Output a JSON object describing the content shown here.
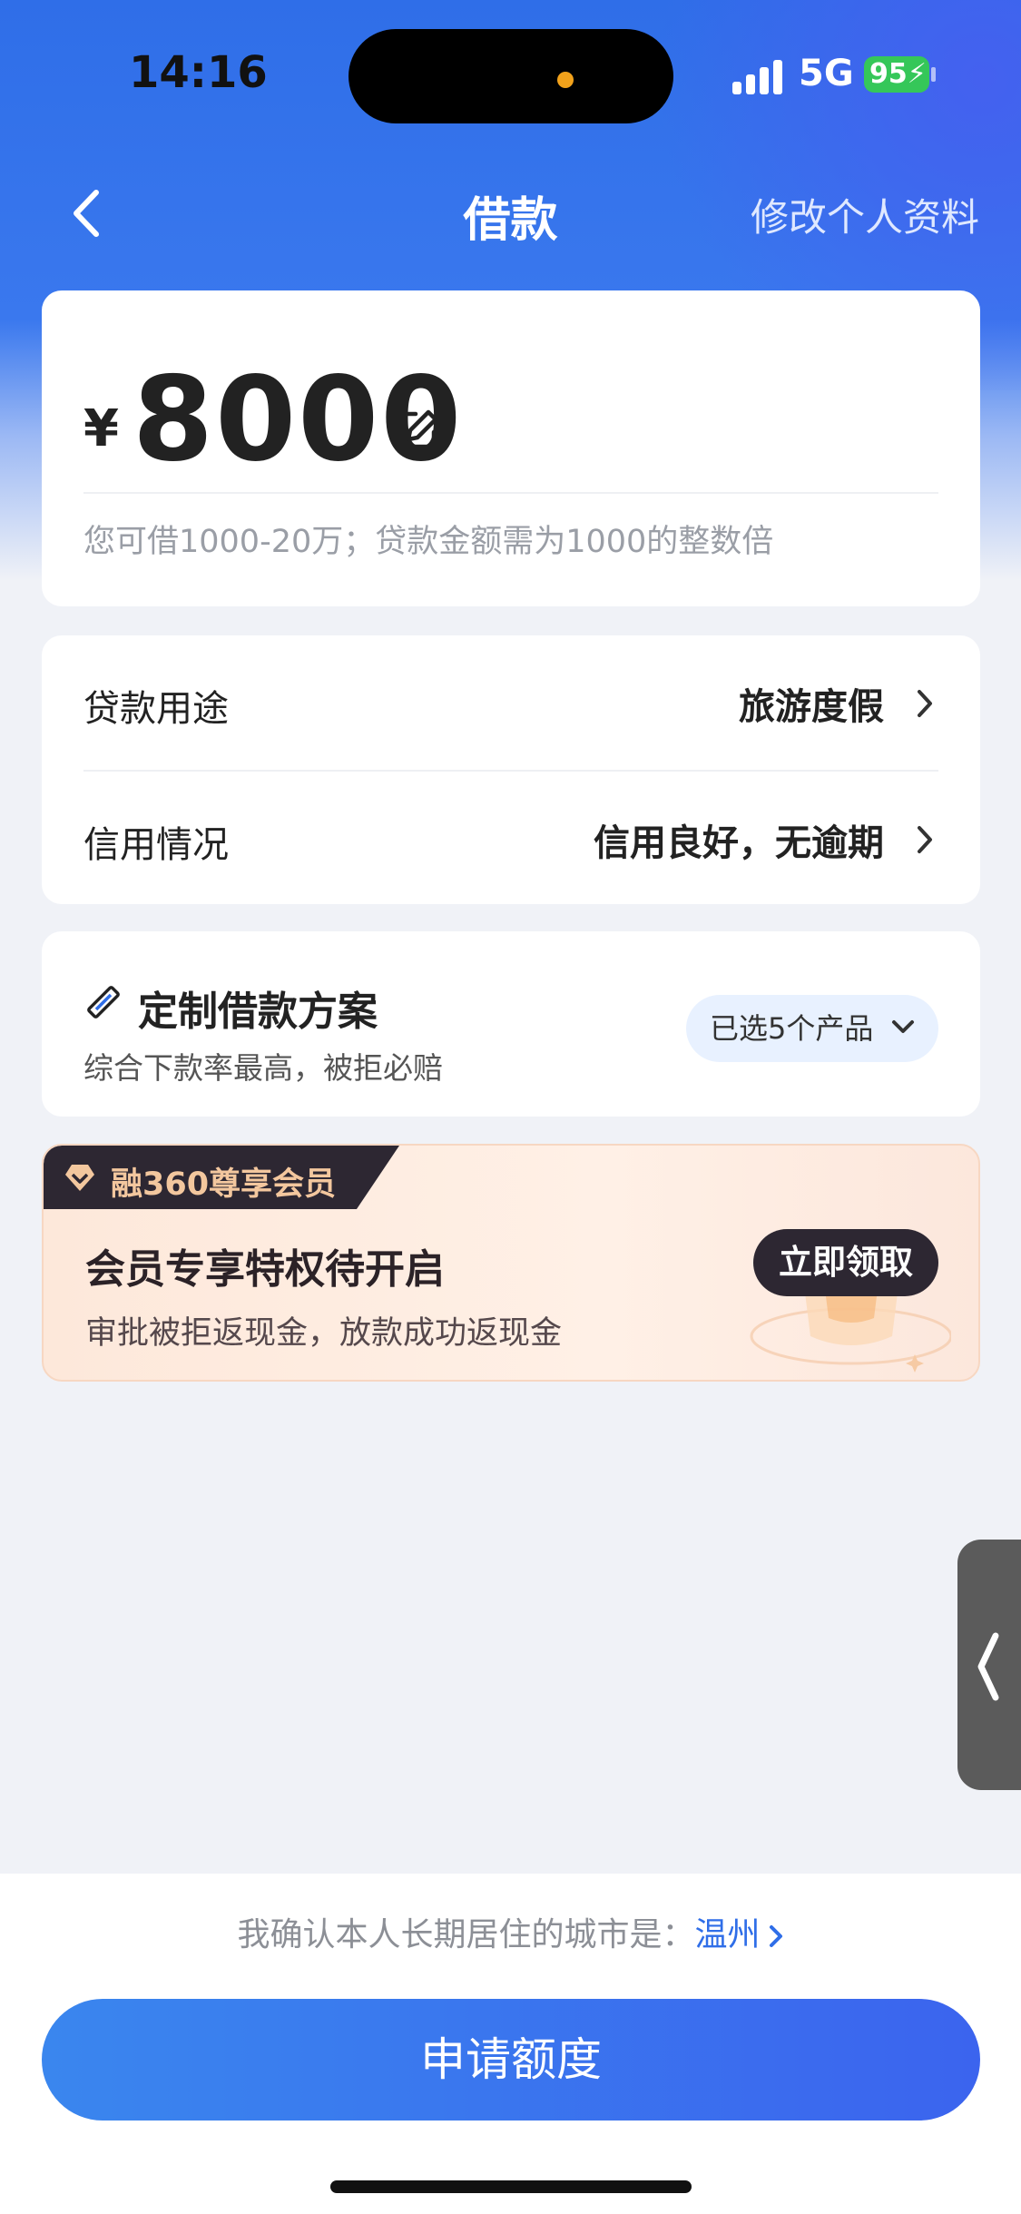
{
  "status_bar": {
    "time": "14:16",
    "network": "5G",
    "battery": "95"
  },
  "nav": {
    "title": "借款",
    "edit_profile": "修改个人资料"
  },
  "amount_card": {
    "currency": "¥",
    "amount": "8000",
    "hint": "您可借1000-20万；贷款金额需为1000的整数倍"
  },
  "info": {
    "rows": [
      {
        "label": "贷款用途",
        "value": "旅游度假"
      },
      {
        "label": "信用情况",
        "value": "信用良好，无逾期"
      }
    ]
  },
  "plan": {
    "title": "定制借款方案",
    "subtitle": "综合下款率最高，被拒必赔",
    "selected": "已选5个产品"
  },
  "vip": {
    "tag": "融360尊享会员",
    "title": "会员专享特权待开启",
    "subtitle": "审批被拒返现金，放款成功返现金",
    "button": "立即领取"
  },
  "footer": {
    "city_prefix": "我确认本人长期居住的城市是：",
    "city": "温州",
    "apply_button": "申请额度"
  },
  "colors": {
    "primary": "#2f6ee8",
    "vip_dark": "#2d2732",
    "vip_gold": "#f3c79e"
  }
}
